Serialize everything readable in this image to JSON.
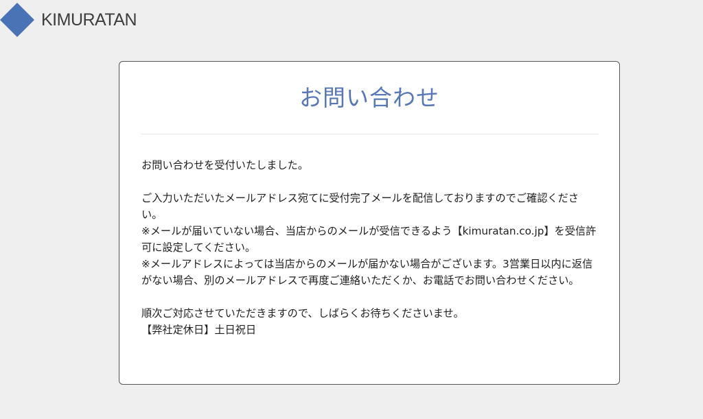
{
  "header": {
    "brand_name": "KIMURATAN",
    "brand_color": "#4a73b5"
  },
  "card": {
    "title": "お問い合わせ",
    "title_color": "#5777b7",
    "messages": [
      "お問い合わせを受付いたしました。",
      "ご入力いただいたメールアドレス宛てに受付完了メールを配信しておりますのでご確認ください。",
      "※メールが届いていない場合、当店からのメールが受信できるよう【kimuratan.co.jp】を受信許可に設定してください。",
      "※メールアドレスによっては当店からのメールが届かない場合がございます。3営業日以内に返信がない場合、別のメールアドレスで再度ご連絡いただくか、お電話でお問い合わせください。",
      "順次ご対応させていただきますので、しばらくお待ちくださいませ。",
      "【弊社定休日】土日祝日"
    ]
  }
}
